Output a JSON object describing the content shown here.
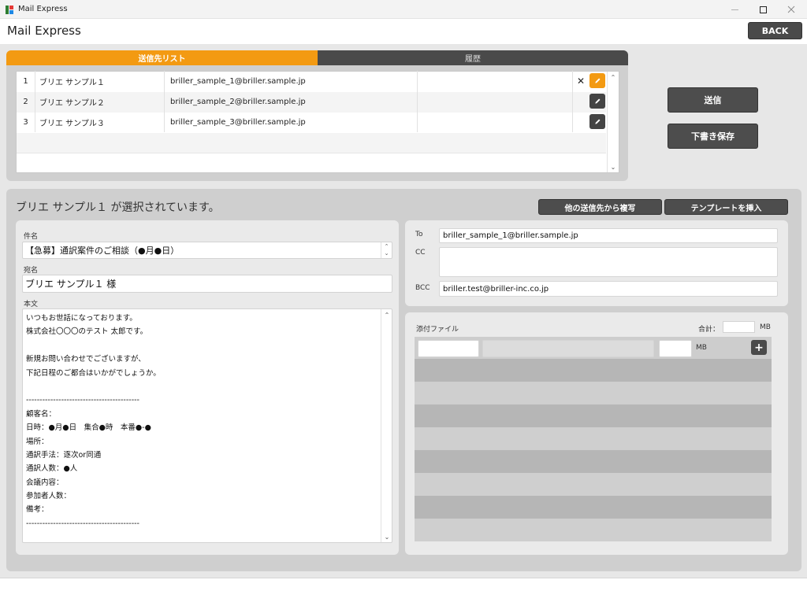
{
  "window": {
    "title": "Mail Express"
  },
  "header": {
    "title": "Mail Express",
    "back_label": "BACK"
  },
  "tabs": {
    "recipients": "送信先リスト",
    "history": "履歴"
  },
  "recipients": [
    {
      "num": "1",
      "name": "ブリエ サンプル１",
      "email": "briller_sample_1@briller.sample.jp",
      "selected": true
    },
    {
      "num": "2",
      "name": "ブリエ サンプル２",
      "email": "briller_sample_2@briller.sample.jp",
      "selected": false
    },
    {
      "num": "3",
      "name": "ブリエ サンプル３",
      "email": "briller_sample_3@briller.sample.jp",
      "selected": false
    }
  ],
  "actions": {
    "send": "送信",
    "save_draft": "下書き保存"
  },
  "compose": {
    "selected_message": "ブリエ サンプル１ が選択されています。",
    "copy_button": "他の送信先から複写",
    "template_button": "テンプレートを挿入",
    "subject_label": "件名",
    "subject_value": "【急募】通訳案件のご相談（●月●日）",
    "to_name_label": "宛名",
    "to_name_value": "ブリエ サンプル１ 様",
    "body_label": "本文",
    "body_lines": [
      "いつもお世話になっております。",
      "株式会社〇〇〇のテスト 太郎です。",
      "",
      "新規お問い合わせでございますが、",
      "下記日程のご都合はいかがでしょうか。",
      "",
      "------------------------------------------",
      "顧客名：",
      "日時：●月●日　集合●時　本番●-●",
      "場所：",
      "通訳手法：逐次or同通",
      "通訳人数：●人",
      "会議内容：",
      "参加者人数：",
      "備考：",
      "------------------------------------------"
    ]
  },
  "addresses": {
    "to_label": "To",
    "to_value": "briller_sample_1@briller.sample.jp",
    "cc_label": "CC",
    "cc_value": "",
    "bcc_label": "BCC",
    "bcc_value": "briller.test@briller-inc.co.jp"
  },
  "attachments": {
    "label": "添付ファイル",
    "total_label": "合計：",
    "total_value": "",
    "unit": "MB",
    "add_label": "+"
  },
  "colors": {
    "accent": "#f39a12",
    "dark_button": "#4a4a4a"
  }
}
